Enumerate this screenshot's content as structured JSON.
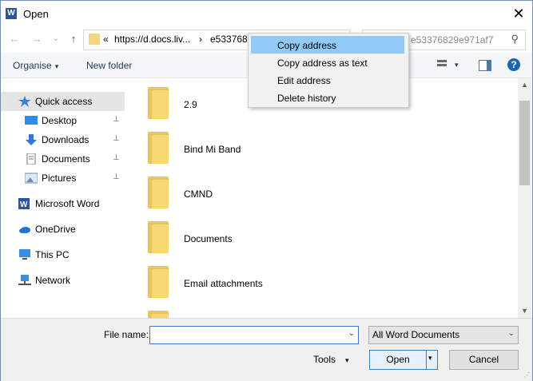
{
  "window": {
    "title": "Open",
    "close_glyph": "✕"
  },
  "nav": {
    "back_glyph": "←",
    "forward_glyph": "→",
    "recent_glyph": "⌄",
    "up_glyph": "↑",
    "address_prefix": "«",
    "address_segments": [
      "https://d.docs.liv...",
      "›",
      "e5337682"
    ],
    "search_placeholder": "e53376829e971af7",
    "search_glyph": "⚲"
  },
  "toolbar": {
    "organise": "Organise",
    "new_folder": "New folder",
    "caret": "▾",
    "help": "?"
  },
  "nav_pane": [
    {
      "label": "Quick access",
      "selected": true,
      "sub": false,
      "pin": false,
      "icon": "star-icon"
    },
    {
      "label": "Desktop",
      "selected": false,
      "sub": true,
      "pin": true,
      "icon": "desktop-icon"
    },
    {
      "label": "Downloads",
      "selected": false,
      "sub": true,
      "pin": true,
      "icon": "download-icon"
    },
    {
      "label": "Documents",
      "selected": false,
      "sub": true,
      "pin": true,
      "icon": "document-icon"
    },
    {
      "label": "Pictures",
      "selected": false,
      "sub": true,
      "pin": true,
      "icon": "pictures-icon"
    },
    {
      "label": "Microsoft Word",
      "selected": false,
      "sub": false,
      "pin": false,
      "icon": "word-icon"
    },
    {
      "label": "OneDrive",
      "selected": false,
      "sub": false,
      "pin": false,
      "icon": "cloud-icon"
    },
    {
      "label": "This PC",
      "selected": false,
      "sub": false,
      "pin": false,
      "icon": "computer-icon"
    },
    {
      "label": "Network",
      "selected": false,
      "sub": false,
      "pin": false,
      "icon": "network-icon"
    }
  ],
  "pin_glyph": "📌",
  "folders": [
    "2.9",
    "Bind Mi Band",
    "CMND",
    "Documents",
    "Email attachments"
  ],
  "bottom": {
    "file_name_label": "File name:",
    "file_name_value": "",
    "filter": "All Word Documents",
    "tools": "Tools",
    "open": "Open",
    "cancel": "Cancel",
    "dropdown_glyph": "⌄"
  },
  "context_menu": {
    "items": [
      "Copy address",
      "Copy address as text",
      "Edit address",
      "Delete history"
    ],
    "highlighted_index": 0
  },
  "colors": {
    "accent": "#3c7fb1",
    "menu_highlight": "#91c9f7",
    "folder": "#f8d875",
    "help": "#1e63b6"
  }
}
